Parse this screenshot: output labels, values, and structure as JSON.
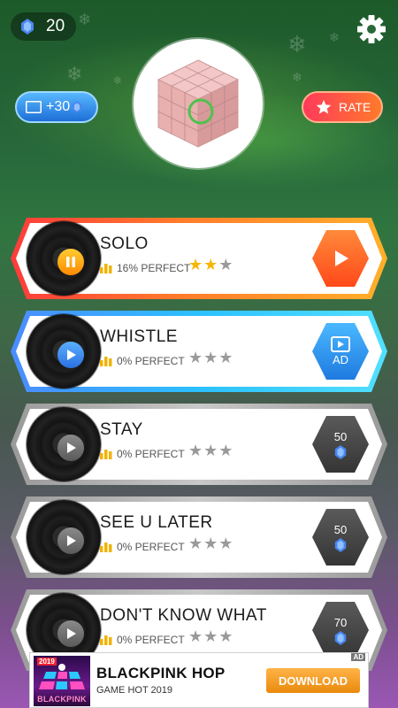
{
  "header": {
    "gem_count": "20"
  },
  "icons": [
    "gem-icon",
    "gear-icon",
    "ad-video-icon",
    "star-icon",
    "play-icon",
    "pause-icon",
    "bars-icon"
  ],
  "bonus": {
    "ad_tag": "AD",
    "amount": "+30"
  },
  "rate": {
    "label": "RATE"
  },
  "songs": [
    {
      "title": "SOLO",
      "perfect": "16% PERFECT",
      "stars_earned": 2,
      "stars_total": 3,
      "state": "playing",
      "action": "play"
    },
    {
      "title": "WHISTLE",
      "perfect": "0% PERFECT",
      "stars_earned": 0,
      "stars_total": 3,
      "state": "ready",
      "action": "ad",
      "action_label": "AD"
    },
    {
      "title": "STAY",
      "perfect": "0% PERFECT",
      "stars_earned": 0,
      "stars_total": 3,
      "state": "locked",
      "action": "buy",
      "price": "50"
    },
    {
      "title": "SEE U LATER",
      "perfect": "0% PERFECT",
      "stars_earned": 0,
      "stars_total": 3,
      "state": "locked",
      "action": "buy",
      "price": "50"
    },
    {
      "title": "DON'T KNOW WHAT",
      "perfect": "0% PERFECT",
      "stars_earned": 0,
      "stars_total": 3,
      "state": "locked",
      "action": "buy",
      "price": "70"
    }
  ],
  "banner": {
    "ad_tag": "AD",
    "year": "2019",
    "icon_text": "BLACKPINK",
    "app_name": "BLACKPINK HOP",
    "app_subtitle": "GAME HOT 2019",
    "cta": "DOWNLOAD"
  },
  "colors": {
    "star_gold": "#f7b500",
    "star_empty": "#9a9a9a",
    "gem_blue": "#3a7bf0",
    "play_orange": "#ff5a1f",
    "ad_blue": "#2aa3f5",
    "locked_gray": "#4a4a4a"
  }
}
